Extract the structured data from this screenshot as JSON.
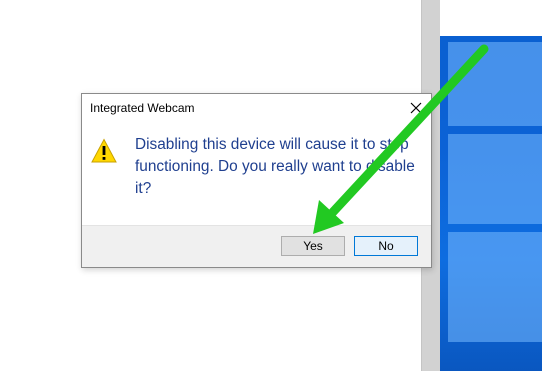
{
  "dialog": {
    "title": "Integrated Webcam",
    "message": "Disabling this device will cause it to stop functioning. Do you really want to disable it?",
    "buttons": {
      "yes": "Yes",
      "no": "No"
    }
  },
  "colors": {
    "message_text": "#1f3f8f",
    "arrow": "#22c922",
    "desktop": "#0b62d6",
    "default_button_border": "#0078d7"
  },
  "icons": {
    "warning": "warning-icon",
    "close": "close-icon",
    "arrow": "green-arrow-annotation"
  }
}
